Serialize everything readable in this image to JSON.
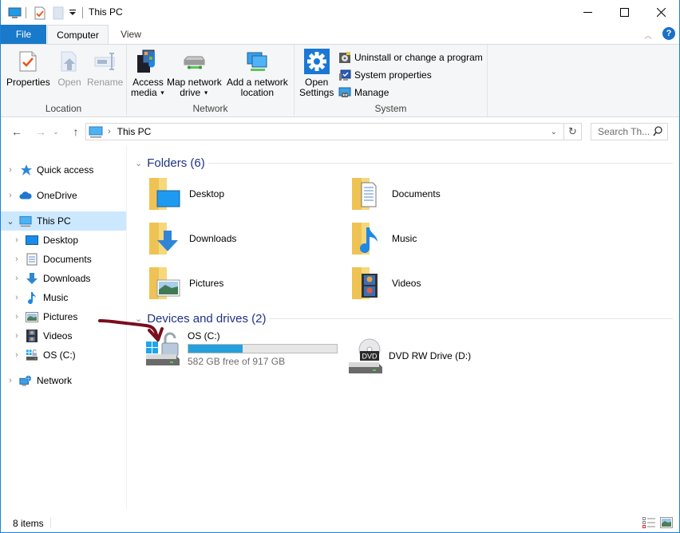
{
  "window": {
    "title": "This PC",
    "controls": {
      "minimize": "–",
      "maximize": "☐",
      "close": "✕"
    }
  },
  "ribbon": {
    "tabs": [
      {
        "label": "File"
      },
      {
        "label": "Computer"
      },
      {
        "label": "View"
      }
    ],
    "groups": {
      "location": {
        "label": "Location",
        "buttons": [
          {
            "label": "Properties",
            "icon": "properties-icon",
            "enabled": true
          },
          {
            "label": "Open",
            "icon": "open-icon",
            "enabled": false
          },
          {
            "label": "Rename",
            "icon": "rename-icon",
            "enabled": false
          }
        ]
      },
      "network": {
        "label": "Network",
        "buttons": [
          {
            "label1": "Access",
            "label2": "media",
            "icon": "access-media-icon",
            "dropdown": true
          },
          {
            "label1": "Map network",
            "label2": "drive",
            "icon": "map-network-drive-icon",
            "dropdown": true
          },
          {
            "label1": "Add a network",
            "label2": "location",
            "icon": "add-network-location-icon",
            "dropdown": false
          }
        ]
      },
      "system": {
        "label": "System",
        "open_settings": {
          "label1": "Open",
          "label2": "Settings",
          "icon": "settings-gear-icon"
        },
        "small_buttons": [
          {
            "label": "Uninstall or change a program",
            "icon": "uninstall-icon"
          },
          {
            "label": "System properties",
            "icon": "system-properties-icon"
          },
          {
            "label": "Manage",
            "icon": "manage-icon"
          }
        ]
      }
    }
  },
  "address": {
    "path": "This PC",
    "search_placeholder": "Search Th..."
  },
  "nav_pane": {
    "items": [
      {
        "label": "Quick access",
        "icon": "quick-access-star-icon",
        "level": 0,
        "expanded": false,
        "selected": false
      },
      {
        "label": "OneDrive",
        "icon": "onedrive-cloud-icon",
        "level": 0,
        "expanded": false,
        "selected": false
      },
      {
        "label": "This PC",
        "icon": "this-pc-icon",
        "level": 0,
        "expanded": true,
        "selected": true
      },
      {
        "label": "Desktop",
        "icon": "desktop-icon",
        "level": 1,
        "expanded": false,
        "selected": false
      },
      {
        "label": "Documents",
        "icon": "documents-icon",
        "level": 1,
        "expanded": false,
        "selected": false
      },
      {
        "label": "Downloads",
        "icon": "downloads-icon",
        "level": 1,
        "expanded": false,
        "selected": false
      },
      {
        "label": "Music",
        "icon": "music-icon",
        "level": 1,
        "expanded": false,
        "selected": false
      },
      {
        "label": "Pictures",
        "icon": "pictures-icon",
        "level": 1,
        "expanded": false,
        "selected": false
      },
      {
        "label": "Videos",
        "icon": "videos-icon",
        "level": 1,
        "expanded": false,
        "selected": false
      },
      {
        "label": "OS (C:)",
        "icon": "os-drive-icon",
        "level": 1,
        "expanded": false,
        "selected": false
      },
      {
        "label": "Network",
        "icon": "network-icon",
        "level": 0,
        "expanded": false,
        "selected": false
      }
    ]
  },
  "content": {
    "folders_header": "Folders (6)",
    "folders": [
      {
        "label": "Desktop",
        "icon": "desktop-folder-icon"
      },
      {
        "label": "Documents",
        "icon": "documents-folder-icon"
      },
      {
        "label": "Downloads",
        "icon": "downloads-folder-icon"
      },
      {
        "label": "Music",
        "icon": "music-folder-icon"
      },
      {
        "label": "Pictures",
        "icon": "pictures-folder-icon"
      },
      {
        "label": "Videos",
        "icon": "videos-folder-icon"
      }
    ],
    "devices_header": "Devices and drives (2)",
    "drives": [
      {
        "label": "OS (C:)",
        "free_text": "582 GB free of 917 GB",
        "used_fraction": 0.365,
        "icon": "os-drive-locked-icon"
      },
      {
        "label": "DVD RW Drive (D:)",
        "icon": "dvd-drive-icon"
      }
    ]
  },
  "status_bar": {
    "items_count": "8 items"
  },
  "colors": {
    "accent": "#1979ca",
    "selected_bg": "#cce8ff",
    "group_header": "#1e3287",
    "drive_bar": "#26a0da",
    "annotation_arrow": "#7a0e1e"
  }
}
